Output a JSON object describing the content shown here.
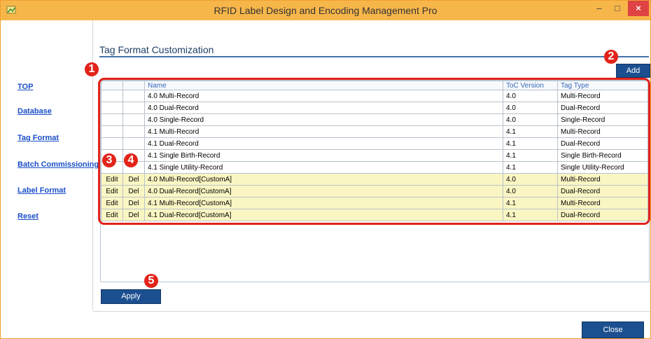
{
  "window": {
    "title": "RFID Label Design and Encoding Management Pro",
    "min_glyph": "–",
    "max_glyph": "□",
    "close_glyph": "×"
  },
  "sidebar": {
    "items": [
      {
        "label": "TOP"
      },
      {
        "label": "Database"
      },
      {
        "label": "Tag Format"
      },
      {
        "label": "Batch Commissioning"
      },
      {
        "label": "Label Format"
      },
      {
        "label": "Reset"
      }
    ]
  },
  "main": {
    "title": "Tag Format Customization",
    "add_label": "Add",
    "apply_label": "Apply",
    "close_label": "Close"
  },
  "table": {
    "headers": [
      "",
      "",
      "Name",
      "ToC Version",
      "Tag Type"
    ],
    "rows": [
      {
        "edit": "",
        "del": "",
        "name": "4.0 Multi-Record",
        "toc": "4.0",
        "type": "Multi-Record"
      },
      {
        "edit": "",
        "del": "",
        "name": "4.0 Dual-Record",
        "toc": "4.0",
        "type": "Dual-Record"
      },
      {
        "edit": "",
        "del": "",
        "name": "4.0 Single-Record",
        "toc": "4.0",
        "type": "Single-Record"
      },
      {
        "edit": "",
        "del": "",
        "name": "4.1 Multi-Record",
        "toc": "4.1",
        "type": "Multi-Record"
      },
      {
        "edit": "",
        "del": "",
        "name": "4.1 Dual-Record",
        "toc": "4.1",
        "type": "Dual-Record"
      },
      {
        "edit": "",
        "del": "",
        "name": "4.1 Single Birth-Record",
        "toc": "4.1",
        "type": "Single Birth-Record"
      },
      {
        "edit": "",
        "del": "",
        "name": "4.1 Single Utility-Record",
        "toc": "4.1",
        "type": "Single Utility-Record"
      },
      {
        "edit": "Edit",
        "del": "Del",
        "name": "4.0 Multi-Record[CustomA]",
        "toc": "4.0",
        "type": "Multi-Record"
      },
      {
        "edit": "Edit",
        "del": "Del",
        "name": "4.0 Dual-Record[CustomA]",
        "toc": "4.0",
        "type": "Dual-Record"
      },
      {
        "edit": "Edit",
        "del": "Del",
        "name": "4.1 Multi-Record[CustomA]",
        "toc": "4.1",
        "type": "Multi-Record"
      },
      {
        "edit": "Edit",
        "del": "Del",
        "name": "4.1 Dual-Record[CustomA]",
        "toc": "4.1",
        "type": "Dual-Record"
      }
    ]
  },
  "annotations": [
    "1",
    "2",
    "3",
    "4",
    "5"
  ]
}
